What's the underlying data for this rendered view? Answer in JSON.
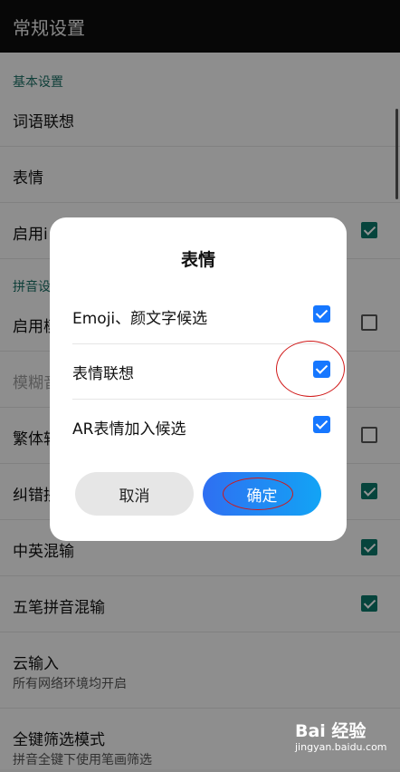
{
  "appbar": {
    "title": "常规设置"
  },
  "settings": {
    "section_basic": "基本设置",
    "row_word_assoc": "词语联想",
    "row_emoji": "表情",
    "row_enable_partial": "启用i",
    "section_pinyin": "拼音设",
    "row_enable2_partial": "启用模",
    "row_fuzzy_partial": "模糊音",
    "row_traditional_partial": "繁体转",
    "row_correction_partial": "纠错拼",
    "row_cn_en": "中英混输",
    "row_wubi": "五笔拼音混输",
    "row_cloud": "云输入",
    "row_cloud_sub": "所有网络环境均开启",
    "row_fullkey": "全键筛选模式",
    "row_fullkey_sub": "拼音全键下使用笔画筛选"
  },
  "dialog": {
    "title": "表情",
    "options": [
      {
        "label": "Emoji、颜文字候选",
        "checked": true
      },
      {
        "label": "表情联想",
        "checked": true
      },
      {
        "label": "AR表情加入候选",
        "checked": true
      }
    ],
    "cancel_label": "取消",
    "ok_label": "确定"
  },
  "watermark": {
    "logo": "Bai 经验",
    "url": "jingyan.baidu.com"
  },
  "colors": {
    "accent_green": "#0b7568",
    "dialog_check_blue": "#1677ff",
    "annotation_red": "#d01818"
  }
}
